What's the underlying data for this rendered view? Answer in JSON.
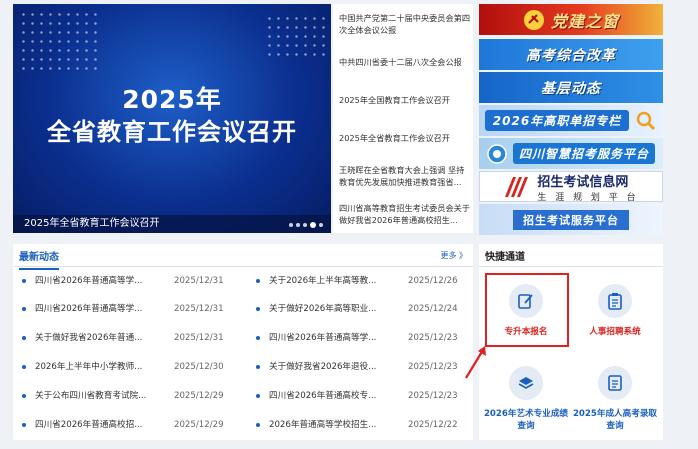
{
  "hero": {
    "year": "2025年",
    "headline": "全省教育工作会议召开",
    "caption": "2025年全省教育工作会议召开"
  },
  "headlines": [
    "中国共产党第二十届中央委员会第四次全体会议公报",
    "中共四川省委十二届八次全会公报",
    "2025年全国教育工作会议召开",
    "2025年全省教育工作会议召开",
    "王晓晖在全省教育大会上强调 坚持教育优先发展加快推进教育强省...",
    "四川省高等教育招生考试委员会关于做好我省2026年普通高校招生..."
  ],
  "banners": {
    "party": "党建之窗",
    "reform": "高考综合改革",
    "grassroots": "基层动态",
    "vocational": "2026年高职单招专栏",
    "smart": "四川智慧招考服务平台",
    "info_title": "招生考试信息网",
    "info_sub": "生 涯 规 划 平 台",
    "service": "招生考试服务平台"
  },
  "news": {
    "title": "最新动态",
    "more": "更多 》",
    "items": [
      {
        "title": "四川省2026年普通高等学...",
        "date": "2025/12/31"
      },
      {
        "title": "关于2026年上半年高等教...",
        "date": "2025/12/26"
      },
      {
        "title": "四川省2026年普通高等学...",
        "date": "2025/12/31"
      },
      {
        "title": "关于做好2026年高等职业...",
        "date": "2025/12/24"
      },
      {
        "title": "关于做好我省2026年普通...",
        "date": "2025/12/31"
      },
      {
        "title": "四川省2026年普通高等学...",
        "date": "2025/12/23"
      },
      {
        "title": "2026年上半年中小学教师...",
        "date": "2025/12/30"
      },
      {
        "title": "关于做好我省2026年退役...",
        "date": "2025/12/23"
      },
      {
        "title": "关于公布四川省教育考试院...",
        "date": "2025/12/29"
      },
      {
        "title": "四川省2026年普通高校专...",
        "date": "2025/12/23"
      },
      {
        "title": "四川省2026年普通高校招...",
        "date": "2025/12/29"
      },
      {
        "title": "2026年普通高等学校招生...",
        "date": "2025/12/22"
      }
    ]
  },
  "quick": {
    "title": "快捷通道",
    "items": [
      {
        "label": "专升本报名",
        "icon": "edit-icon"
      },
      {
        "label": "人事招聘系统",
        "icon": "clipboard-icon"
      },
      {
        "label": "2026年艺术专业成绩查询",
        "icon": "layers-icon"
      },
      {
        "label": "2025年成人高考录取查询",
        "icon": "document-icon"
      }
    ]
  },
  "colors": {
    "accent": "#1a5fbf",
    "highlight": "#e02020"
  }
}
